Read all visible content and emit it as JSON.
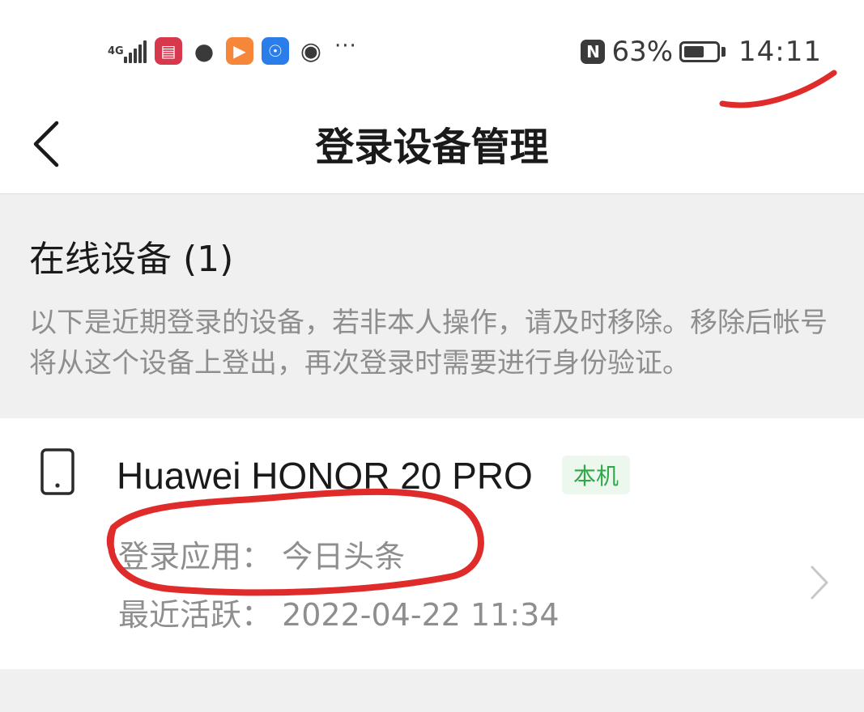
{
  "status_bar": {
    "network": "4G",
    "apps": [
      {
        "name": "reader-app-icon",
        "color": "#d8384c",
        "glyph": "▤"
      },
      {
        "name": "wechat-icon",
        "color": "#3a3a3a",
        "glyph": "●"
      },
      {
        "name": "video-app-icon",
        "color": "#f6873a",
        "glyph": "▶"
      },
      {
        "name": "bulb-app-icon",
        "color": "#2b7de9",
        "glyph": "☉"
      },
      {
        "name": "browser-app-icon",
        "color": "#3a3a3a",
        "glyph": "◉"
      }
    ],
    "more": "···",
    "nfc": "N",
    "battery_percent": "63%",
    "battery_level": 0.63,
    "time": "14:11"
  },
  "nav": {
    "title": "登录设备管理"
  },
  "online_section": {
    "title": "在线设备 (1)",
    "description": "以下是近期登录的设备，若非本人操作，请及时移除。移除后帐号将从这个设备上登出，再次登录时需要进行身份验证。"
  },
  "devices": [
    {
      "name": "Huawei HONOR 20 PRO",
      "badge": "本机",
      "app_line": "登录应用：  今日头条",
      "active_line": "最近活跃：  2022-04-22 11:34"
    }
  ],
  "colors": {
    "badge_bg": "#ecf7ee",
    "badge_text": "#2fa84a",
    "annotation_red": "#e02b2b",
    "muted_text": "#8e8e8e"
  }
}
